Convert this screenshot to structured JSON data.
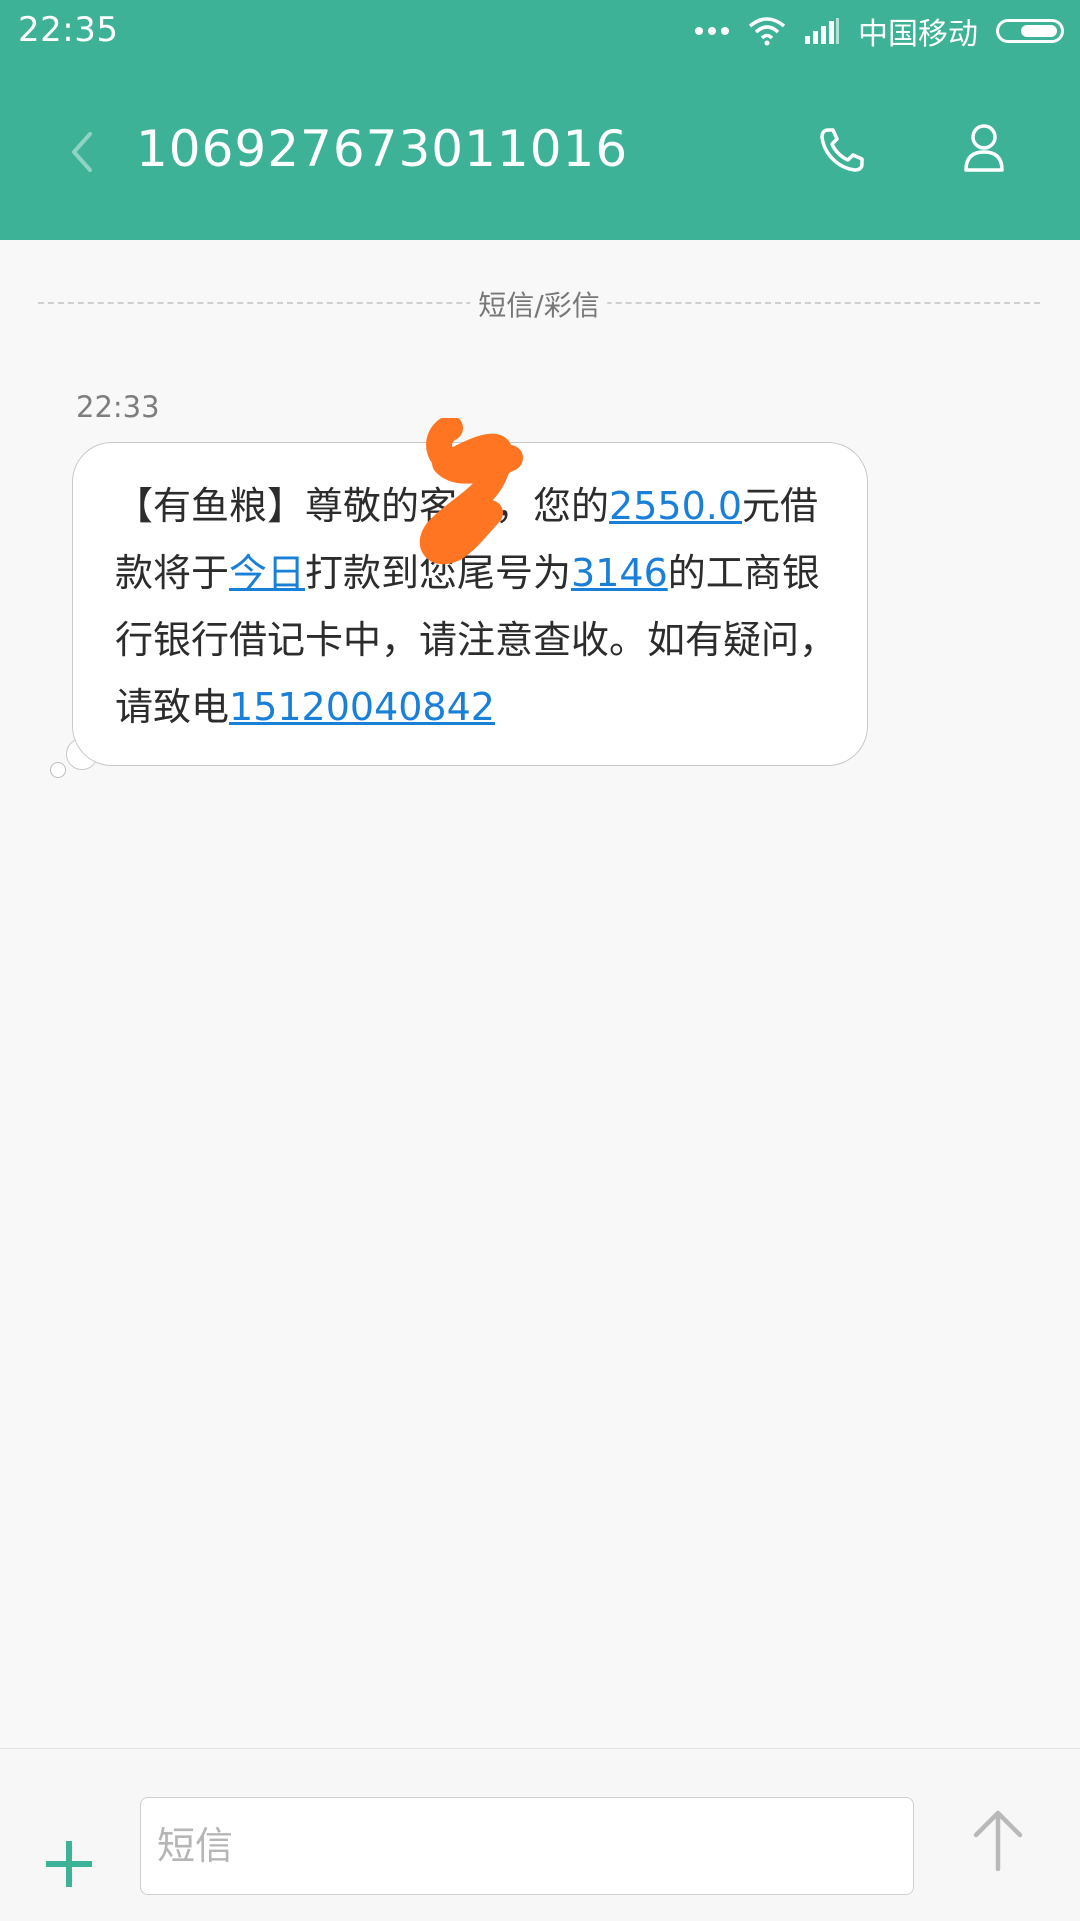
{
  "status_bar": {
    "time": "22:35",
    "carrier": "中国移动",
    "icons": [
      "more-dots-icon",
      "wifi-icon",
      "signal-icon",
      "battery-icon"
    ]
  },
  "header": {
    "title": "106927673011016",
    "icons": [
      "back-arrow-icon",
      "phone-icon",
      "contact-icon"
    ],
    "background": "#3db296"
  },
  "conversation": {
    "divider_label": "短信/彩信",
    "message": {
      "time": "22:33",
      "segments": [
        {
          "text": "【有鱼粮】尊敬的",
          "link": false
        },
        {
          "text": "客户",
          "link": false,
          "redacted": true
        },
        {
          "text": "，您的",
          "link": false
        },
        {
          "text": "2550.0",
          "link": true
        },
        {
          "text": "元借款将于",
          "link": false
        },
        {
          "text": "今日",
          "link": true
        },
        {
          "text": "打款到您尾号为",
          "link": false
        },
        {
          "text": "3146",
          "link": true
        },
        {
          "text": "的工商银行银行借记卡中，请注意查收。如有疑问，请致电",
          "link": false
        },
        {
          "text": "15120040842",
          "link": true
        }
      ]
    }
  },
  "composer": {
    "placeholder": "短信",
    "value": "",
    "icons": [
      "add-icon",
      "send-arrow-icon"
    ]
  },
  "colors": {
    "accent": "#3db296",
    "link": "#1a7fd6",
    "redaction": "#ff7522"
  }
}
